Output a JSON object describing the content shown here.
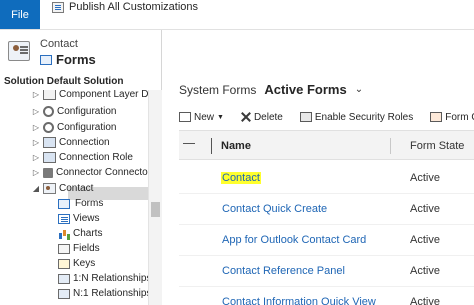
{
  "ribbon": {
    "file_label": "File",
    "publish_label": "Publish All Customizations"
  },
  "leftnav": {
    "entity_name": "Contact",
    "entity_section": "Forms",
    "solution_label": "Solution Default Solution",
    "tree": [
      {
        "label": "Component Layer D...",
        "icon": "layer-icon",
        "expanded": false
      },
      {
        "label": "Configuration",
        "icon": "gear-icon",
        "expanded": false
      },
      {
        "label": "Configuration",
        "icon": "gear-icon",
        "expanded": false
      },
      {
        "label": "Connection",
        "icon": "connection-icon",
        "expanded": false
      },
      {
        "label": "Connection Role",
        "icon": "connection-role-icon",
        "expanded": false
      },
      {
        "label": "Connector Connector",
        "icon": "connector-icon",
        "expanded": false
      },
      {
        "label": "Contact",
        "icon": "contact-icon",
        "expanded": true
      },
      {
        "label": "Forms",
        "icon": "forms-icon",
        "selected": true
      },
      {
        "label": "Views",
        "icon": "views-icon"
      },
      {
        "label": "Charts",
        "icon": "charts-icon"
      },
      {
        "label": "Fields",
        "icon": "fields-icon"
      },
      {
        "label": "Keys",
        "icon": "keys-icon"
      },
      {
        "label": "1:N Relationships",
        "icon": "relationship-icon"
      },
      {
        "label": "N:1 Relationships",
        "icon": "relationship-icon"
      }
    ]
  },
  "main": {
    "view_prefix": "System Forms",
    "view_name": "Active Forms",
    "toolbar": {
      "new_label": "New",
      "delete_label": "Delete",
      "security_label": "Enable Security Roles",
      "form_order_label": "Form O"
    },
    "columns": {
      "name": "Name",
      "state": "Form State"
    },
    "rows": [
      {
        "name": "Contact",
        "state": "Active",
        "highlighted": true
      },
      {
        "name": "Contact Quick Create",
        "state": "Active"
      },
      {
        "name": "App for Outlook Contact Card",
        "state": "Active"
      },
      {
        "name": "Contact Reference Panel",
        "state": "Active"
      },
      {
        "name": "Contact Information Quick View",
        "state": "Active"
      }
    ]
  },
  "colors": {
    "file_tab": "#0f6cbd",
    "link": "#1f66b5",
    "highlight": "#ffff2e",
    "selection": "#d9d9d9"
  }
}
